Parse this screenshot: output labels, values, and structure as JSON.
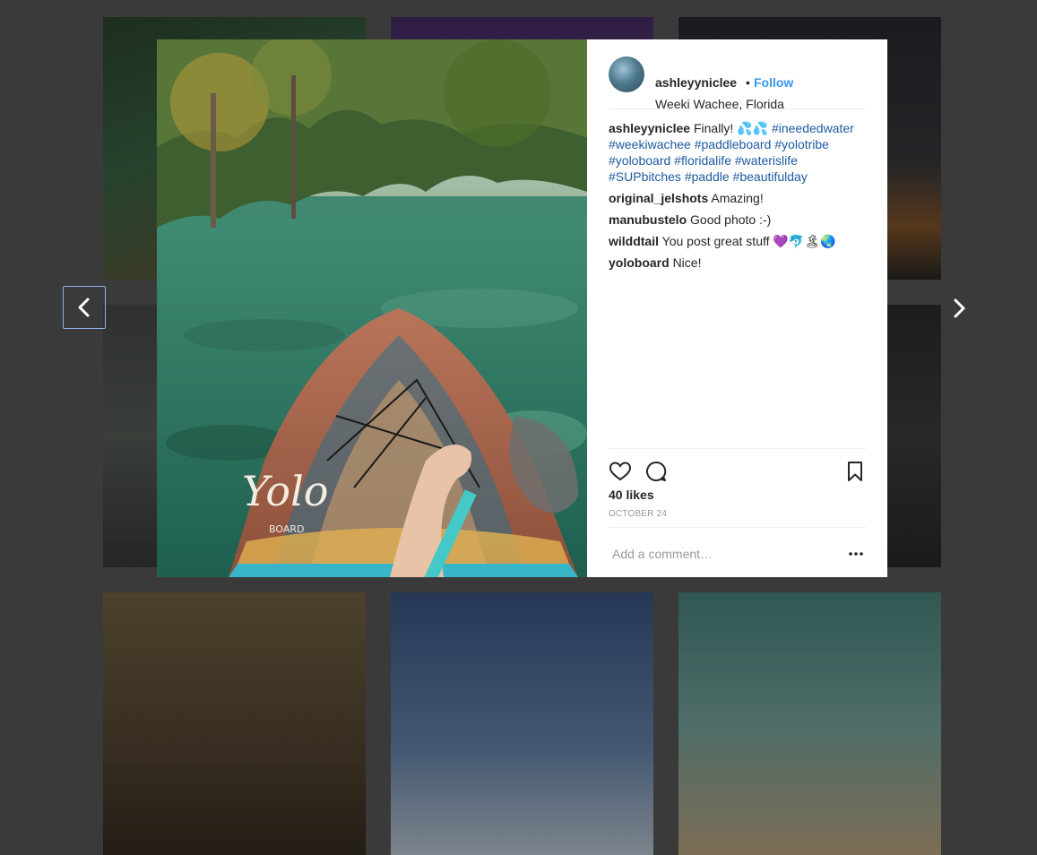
{
  "post": {
    "username": "ashleyyniclee",
    "separator": "•",
    "follow_label": "Follow",
    "location": "Weeki Wachee, Florida",
    "caption_user": "ashleyyniclee",
    "caption_text": "Finally! 💦💦",
    "hashtags": [
      "#ineededwater",
      "#weekiwachee",
      "#paddleboard",
      "#yolotribe",
      "#yoloboard",
      "#floridalife",
      "#waterislife",
      "#SUPbitches",
      "#paddle",
      "#beautifulday"
    ],
    "comments": [
      {
        "user": "original_jelshots",
        "text": "Amazing!"
      },
      {
        "user": "manubustelo",
        "text": "Good photo :-)"
      },
      {
        "user": "wilddtail",
        "text": "You post great stuff 💜🐬🏝🌏"
      },
      {
        "user": "yoloboard",
        "text": "Nice!"
      }
    ],
    "likes": "40 likes",
    "date": "OCTOBER 24",
    "comment_placeholder": "Add a comment…"
  },
  "photo": {
    "board_brand": "Yolo",
    "board_brand_sub": "BOARD"
  },
  "icons": {
    "prev": "chevron-left-icon",
    "next": "chevron-right-icon",
    "like": "heart-icon",
    "comment": "comment-bubble-icon",
    "save": "bookmark-icon",
    "more": "more-options-icon"
  },
  "colors": {
    "link_blue": "#3897f0",
    "hashtag_blue": "#1e5aa0",
    "text": "#262626",
    "muted": "#999999"
  }
}
